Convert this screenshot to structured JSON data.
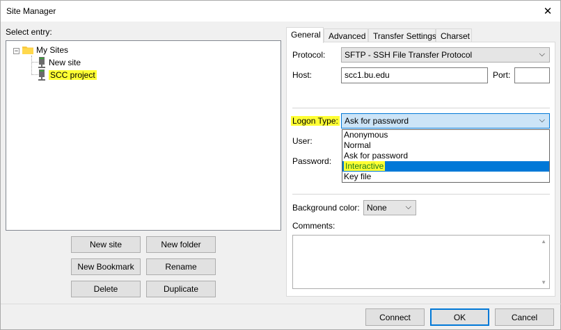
{
  "window": {
    "title": "Site Manager",
    "close_glyph": "✕"
  },
  "tree": {
    "label": "Select entry:",
    "expander": "−",
    "root": "My Sites",
    "items": [
      {
        "label": "New site"
      },
      {
        "label": "SCC project"
      }
    ]
  },
  "left_buttons": {
    "new_site": "New site",
    "new_folder": "New folder",
    "new_bookmark": "New Bookmark",
    "rename": "Rename",
    "delete": "Delete",
    "duplicate": "Duplicate"
  },
  "tabs": [
    "General",
    "Advanced",
    "Transfer Settings",
    "Charset"
  ],
  "general": {
    "protocol_label": "Protocol:",
    "protocol_value": "SFTP - SSH File Transfer Protocol",
    "host_label": "Host:",
    "host_value": "scc1.bu.edu",
    "port_label": "Port:",
    "port_value": "",
    "logon_label": "Logon Type:",
    "logon_value": "Ask for password",
    "logon_options": [
      "Anonymous",
      "Normal",
      "Ask for password",
      "Interactive",
      "Key file"
    ],
    "logon_highlighted_option": "Interactive",
    "user_label": "User:",
    "password_label": "Password:",
    "bg_color_label": "Background color:",
    "bg_color_value": "None",
    "comments_label": "Comments:",
    "comments_value": ""
  },
  "footer": {
    "connect": "Connect",
    "ok": "OK",
    "cancel": "Cancel"
  },
  "colors": {
    "highlight_marker": "#ffff33",
    "accent": "#0078d7"
  },
  "icons": {
    "chevron": "⌵",
    "scroll_up": "▲",
    "scroll_down": "▼"
  }
}
